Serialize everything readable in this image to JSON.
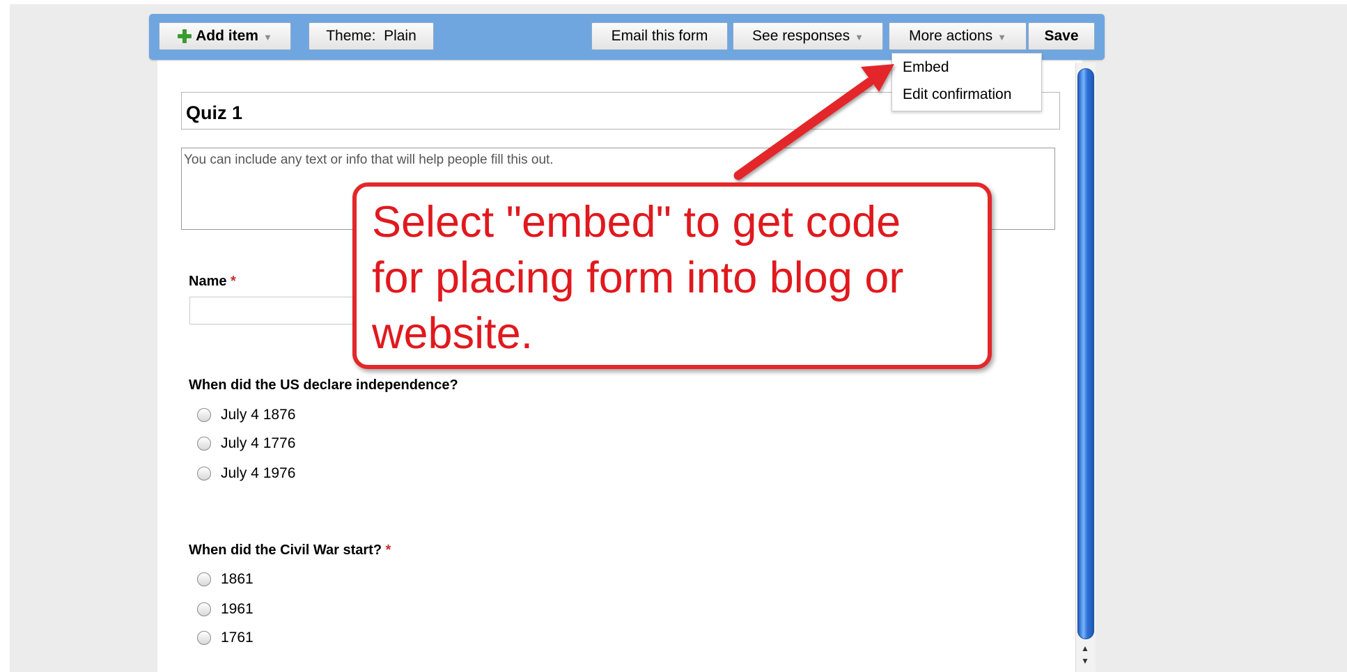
{
  "toolbar": {
    "add_item_label": "Add item",
    "theme_label": "Theme:  Plain",
    "email_label": "Email this form",
    "see_responses_label": "See responses",
    "more_actions_label": "More actions",
    "save_label": "Save"
  },
  "more_actions_menu": {
    "items": [
      {
        "label": "Embed"
      },
      {
        "label": "Edit confirmation"
      }
    ]
  },
  "form": {
    "title": "Quiz 1",
    "description": "You can include any text or info that will help people fill this out.",
    "questions": [
      {
        "label": "Name",
        "required_mark": "*",
        "value": ""
      },
      {
        "label": "When did the US declare independence?",
        "options": [
          "July 4 1876",
          "July 4 1776",
          "July 4 1976"
        ]
      },
      {
        "label": "When did the Civil War start?",
        "required_mark": "*",
        "options": [
          "1861",
          "1961",
          "1761"
        ]
      }
    ]
  },
  "callout": {
    "lines": [
      "Select \"embed\" to get code",
      "for placing form into blog or",
      "website."
    ]
  },
  "colors": {
    "toolbar_bg": "#6fa6e0",
    "callout_red": "#e3272a",
    "required_red": "#c62f2f",
    "add_icon_green": "#3a9b2e"
  }
}
